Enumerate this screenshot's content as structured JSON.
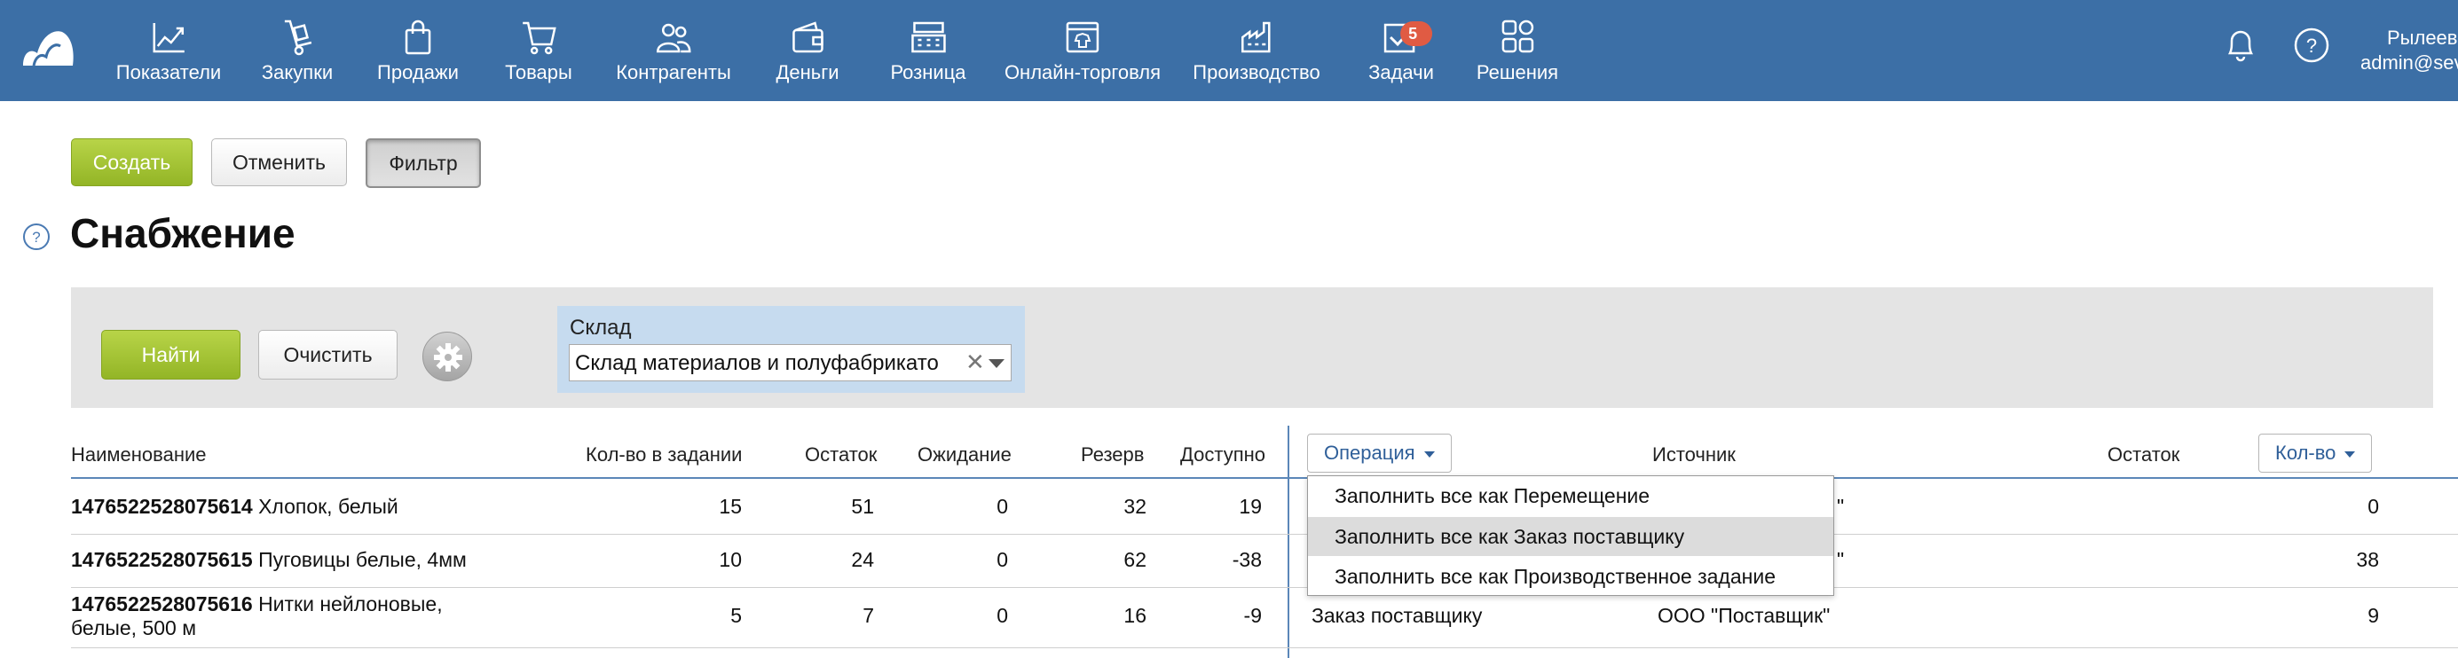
{
  "nav": {
    "items": [
      {
        "label": "Показатели",
        "icon": "chart-icon"
      },
      {
        "label": "Закупки",
        "icon": "cart-dolly-icon"
      },
      {
        "label": "Продажи",
        "icon": "shopping-bag-icon"
      },
      {
        "label": "Товары",
        "icon": "shopping-cart-icon"
      },
      {
        "label": "Контрагенты",
        "icon": "people-icon"
      },
      {
        "label": "Деньги",
        "icon": "wallet-icon"
      },
      {
        "label": "Розница",
        "icon": "cash-register-icon"
      },
      {
        "label": "Онлайн-торговля",
        "icon": "online-shop-icon"
      },
      {
        "label": "Производство",
        "icon": "factory-icon"
      },
      {
        "label": "Задачи",
        "icon": "tasks-check-icon",
        "badge": "5"
      },
      {
        "label": "Решения",
        "icon": "solutions-grid-icon"
      }
    ],
    "user_name": "Рылеев",
    "user_email": "admin@sev"
  },
  "toolbar": {
    "create": "Создать",
    "cancel": "Отменить",
    "filter": "Фильтр"
  },
  "page": {
    "title": "Снабжение"
  },
  "filter": {
    "find": "Найти",
    "clear": "Очистить",
    "warehouse_label": "Склад",
    "warehouse_value": "Склад материалов и полуфабрикато",
    "clear_glyph": "✕"
  },
  "table": {
    "headers": {
      "name": "Наименование",
      "task_qty": "Кол-во в задании",
      "stock": "Остаток",
      "waiting": "Ожидание",
      "reserve": "Резерв",
      "available": "Доступно",
      "operation": "Операция",
      "source": "Источник",
      "stock2": "Остаток",
      "qty": "Кол-во"
    },
    "rows": [
      {
        "code": "1476522528075614",
        "name": "Хлопок, белый",
        "task_qty": "15",
        "stock": "51",
        "waiting": "0",
        "reserve": "32",
        "available": "19",
        "operation": "",
        "source": "\"",
        "stock2": "0"
      },
      {
        "code": "1476522528075615",
        "name": "Пуговицы белые, 4мм",
        "task_qty": "10",
        "stock": "24",
        "waiting": "0",
        "reserve": "62",
        "available": "-38",
        "operation": "",
        "source": "\"",
        "stock2": "38"
      },
      {
        "code": "1476522528075616",
        "name": "Нитки нейлоновые,",
        "name2": "белые, 500 м",
        "task_qty": "5",
        "stock": "7",
        "waiting": "0",
        "reserve": "16",
        "available": "-9",
        "operation": "Заказ поставщику",
        "source": "ООО \"Поставщик\"",
        "stock2": "9"
      }
    ]
  },
  "dropdown": {
    "items": [
      "Заполнить все как Перемещение",
      "Заполнить все как Заказ поставщику",
      "Заполнить все как Производственное задание"
    ]
  },
  "colors": {
    "nav_bg": "#3c6fa6",
    "accent_green": "#93b526",
    "badge": "#e05b43",
    "link": "#2f5f99"
  }
}
